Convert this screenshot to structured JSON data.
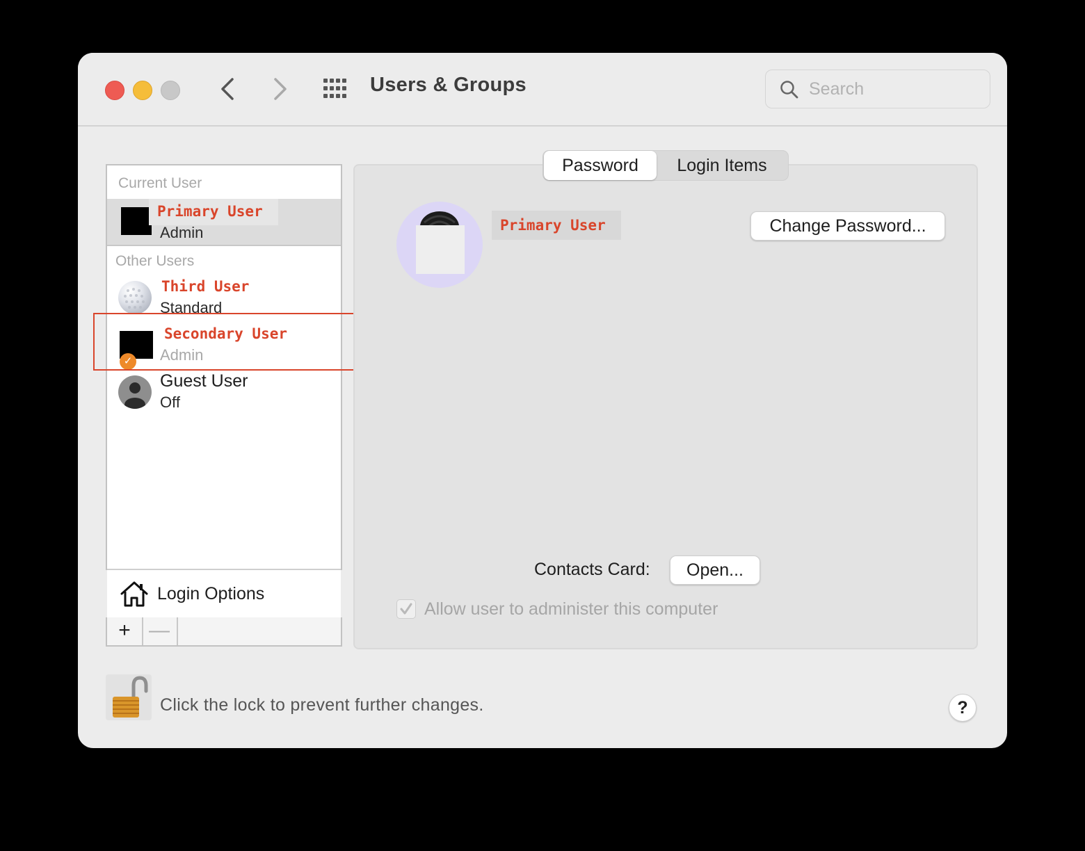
{
  "window": {
    "title": "Users & Groups",
    "search_placeholder": "Search"
  },
  "sidebar": {
    "current_user_label": "Current User",
    "other_users_label": "Other Users",
    "users": [
      {
        "name": "Primary User",
        "role": "Admin"
      },
      {
        "name": "Third User",
        "role": "Standard"
      },
      {
        "name": "Secondary User",
        "role": "Admin"
      },
      {
        "name": "Guest User",
        "role": "Off"
      }
    ],
    "login_options_label": "Login Options",
    "add_label": "+",
    "remove_label": "—"
  },
  "tabs": [
    "Password",
    "Login Items"
  ],
  "detail": {
    "user_name": "Primary User",
    "change_password_label": "Change Password...",
    "contacts_card_label": "Contacts Card:",
    "open_label": "Open...",
    "allow_admin_label": "Allow user to administer this computer",
    "allow_admin_checked": true
  },
  "footer": {
    "lock_text": "Click the lock to prevent further changes.",
    "help_label": "?"
  },
  "colors": {
    "close": "#ee5b53",
    "minimize": "#f5bd3a",
    "zoom": "#c8c8c8",
    "redacted_name": "#d9452b",
    "highlight_box": "#d9452b"
  }
}
